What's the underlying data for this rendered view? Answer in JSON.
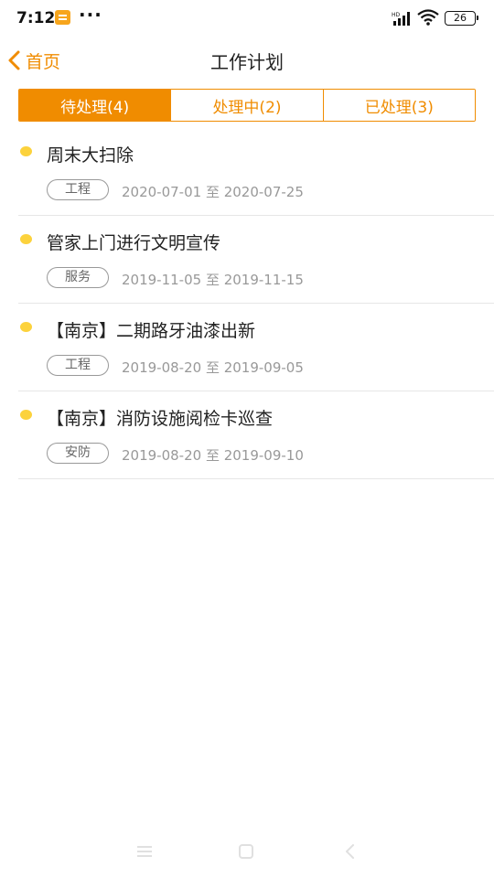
{
  "status_bar": {
    "time": "7:12",
    "dots": "···",
    "battery": "26",
    "signal_label": "HD"
  },
  "header": {
    "back_label": "首页",
    "title": "工作计划"
  },
  "tabs": [
    {
      "label": "待处理(4)",
      "active": true
    },
    {
      "label": "处理中(2)",
      "active": false
    },
    {
      "label": "已处理(3)",
      "active": false
    }
  ],
  "tasks": [
    {
      "title": "周末大扫除",
      "tag": "工程",
      "date": "2020-07-01 至 2020-07-25"
    },
    {
      "title": "管家上门进行文明宣传",
      "tag": "服务",
      "date": "2019-11-05 至 2019-11-15"
    },
    {
      "title": "【南京】二期路牙油漆出新",
      "tag": "工程",
      "date": "2019-08-20 至 2019-09-05"
    },
    {
      "title": "【南京】消防设施阅检卡巡查",
      "tag": "安防",
      "date": "2019-08-20 至 2019-09-10"
    }
  ],
  "colors": {
    "accent": "#f08c00",
    "dot": "#fcd23c",
    "divider": "#e6e6e6"
  },
  "icons": {
    "back": "chevron-left-icon",
    "menu": "menu-icon",
    "home": "square-icon",
    "nav_back": "chevron-left-icon"
  }
}
